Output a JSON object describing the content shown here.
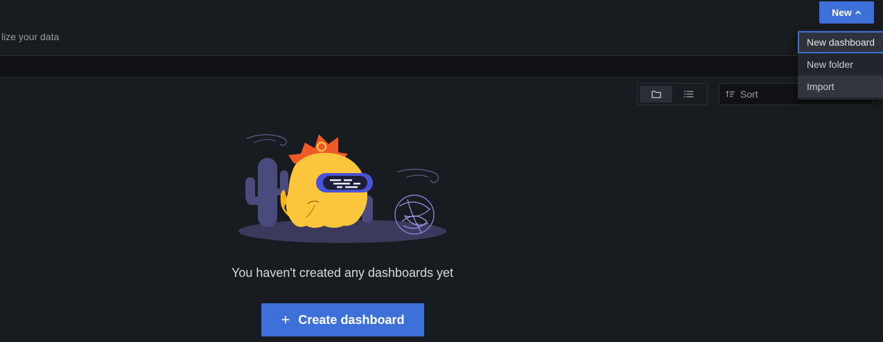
{
  "header": {
    "subtitle": "lize your data",
    "new_button_label": "New"
  },
  "new_menu": {
    "items": [
      {
        "label": "New dashboard",
        "state": "focused"
      },
      {
        "label": "New folder",
        "state": "normal"
      },
      {
        "label": "Import",
        "state": "hover"
      }
    ]
  },
  "toolbar": {
    "view_modes": [
      "folder-view",
      "list-view"
    ],
    "active_view": "folder-view",
    "sort_label": "Sort"
  },
  "empty_state": {
    "message": "You haven't created any dashboards yet",
    "create_button_label": "Create dashboard"
  },
  "colors": {
    "background": "#181b1f",
    "accent": "#3d71d9",
    "menu_bg": "#22252b"
  }
}
